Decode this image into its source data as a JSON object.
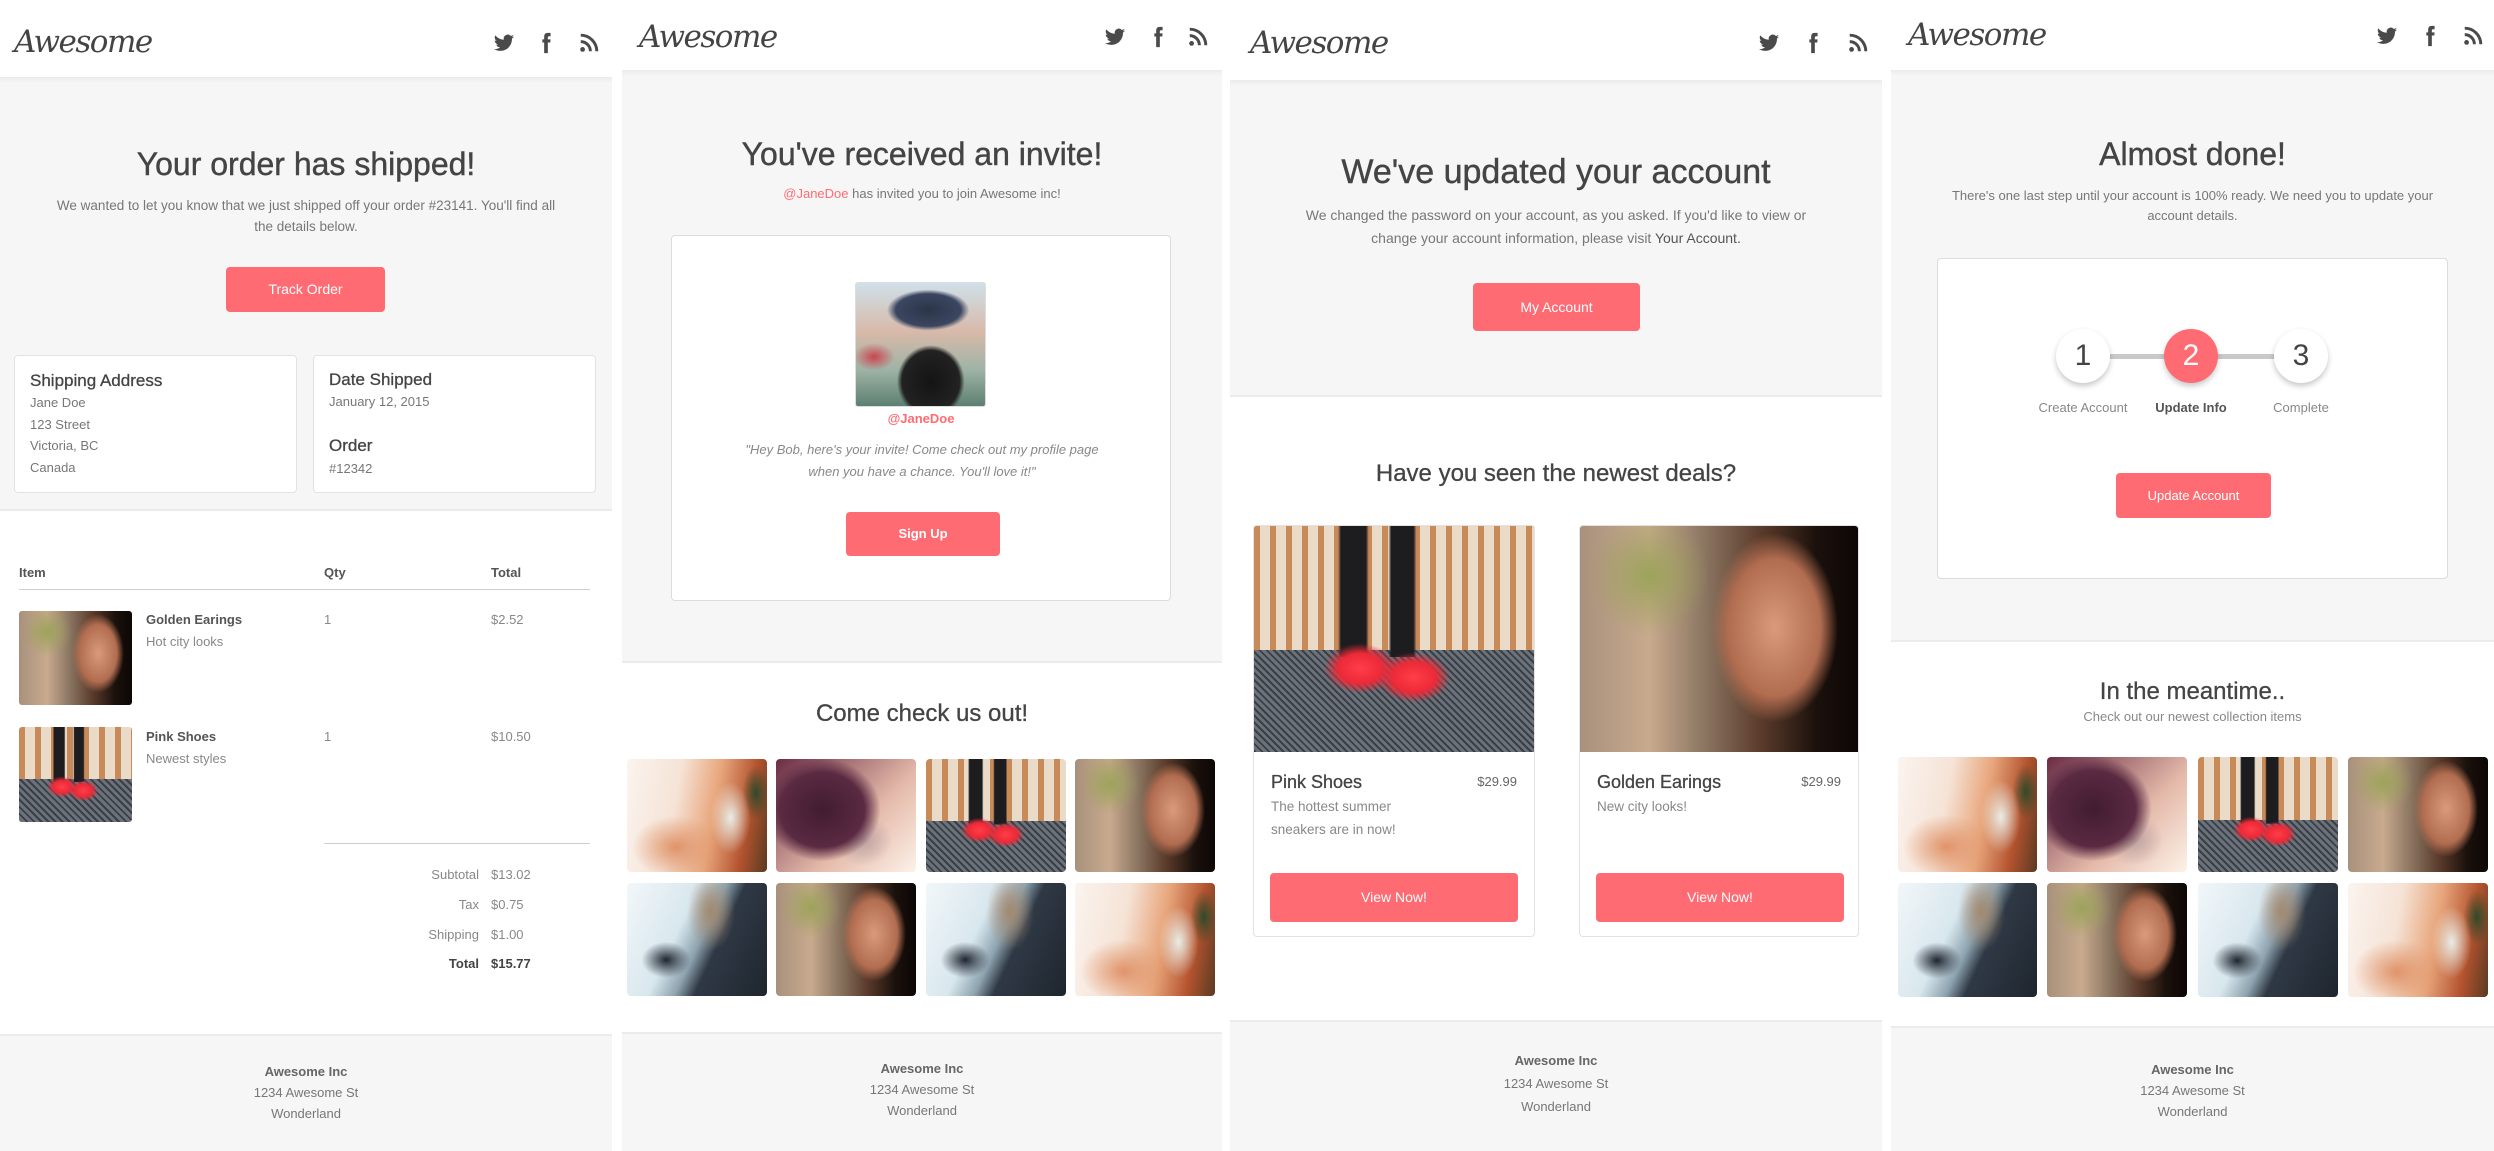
{
  "accent_color": "#ff6b72",
  "brand": {
    "logo": "Awesome",
    "social_icons": [
      "twitter-icon",
      "facebook-icon",
      "rss-icon"
    ]
  },
  "footer": {
    "company": "Awesome Inc",
    "street": "1234 Awesome St",
    "city": "Wonderland"
  },
  "emails": {
    "shipped": {
      "title": "Your order has shipped!",
      "body": "We wanted to let you know that we just shipped off your order #23141. You'll find all the details below.",
      "button": "Track Order",
      "shipping_address": {
        "heading": "Shipping Address",
        "lines": [
          "Jane Doe",
          "123 Street",
          "Victoria, BC",
          "Canada"
        ]
      },
      "date_shipped": {
        "heading": "Date Shipped",
        "value": "January 12, 2015"
      },
      "order": {
        "heading": "Order",
        "value": "#12342"
      },
      "table": {
        "headers": {
          "item": "Item",
          "qty": "Qty",
          "total": "Total"
        },
        "rows": [
          {
            "name": "Golden Earings",
            "desc": "Hot city looks",
            "qty": "1",
            "total": "$2.52",
            "image": "earrings"
          },
          {
            "name": "Pink Shoes",
            "desc": "Newest styles",
            "qty": "1",
            "total": "$10.50",
            "image": "shoes"
          }
        ]
      },
      "summary": [
        {
          "label": "Subtotal",
          "value": "$13.02"
        },
        {
          "label": "Tax",
          "value": "$0.75"
        },
        {
          "label": "Shipping",
          "value": "$1.00"
        },
        {
          "label": "Total",
          "value": "$15.77"
        }
      ]
    },
    "invite": {
      "title": "You've received an invite!",
      "inviter": "@JaneDoe",
      "invite_text": " has invited you to join Awesome inc!",
      "profile_handle": "@JaneDoe",
      "quote": "\"Hey Bob, here's your invite! Come check out my profile page when you have a chance. You'll love it!\"",
      "button": "Sign Up",
      "gallery_title": "Come check us out!",
      "gallery": [
        "drink",
        "hat",
        "shoes",
        "earrings",
        "jacket",
        "earrings",
        "jacket",
        "drink"
      ]
    },
    "account_updated": {
      "title": "We've updated your account",
      "body": "We changed the password on your account, as you asked. If you'd like to view or change your account information, please visit ",
      "body_link": "Your Account.",
      "button": "My Account",
      "deals_title": "Have you seen the newest deals?",
      "deals": [
        {
          "name": "Pink Shoes",
          "price": "$29.99",
          "desc": "The hottest summer sneakers are in now!",
          "button": "View Now!",
          "image": "shoes"
        },
        {
          "name": "Golden Earings",
          "price": "$29.99",
          "desc": "New city looks!",
          "button": "View Now!",
          "image": "earrings"
        }
      ]
    },
    "almost_done": {
      "title": "Almost done!",
      "body": "There's one last step until your account is 100% ready. We need you to update your account details.",
      "current_step": 2,
      "steps": [
        {
          "number": "1",
          "label": "Create Account",
          "state": "done"
        },
        {
          "number": "2",
          "label": "Update Info",
          "state": "active"
        },
        {
          "number": "3",
          "label": "Complete",
          "state": "pending"
        }
      ],
      "button": "Update Account",
      "meantime_title": "In the meantime..",
      "meantime_subtitle": "Check out our newest collection items",
      "gallery": [
        "drink",
        "hat",
        "shoes",
        "earrings",
        "jacket",
        "earrings",
        "jacket",
        "drink"
      ]
    }
  }
}
